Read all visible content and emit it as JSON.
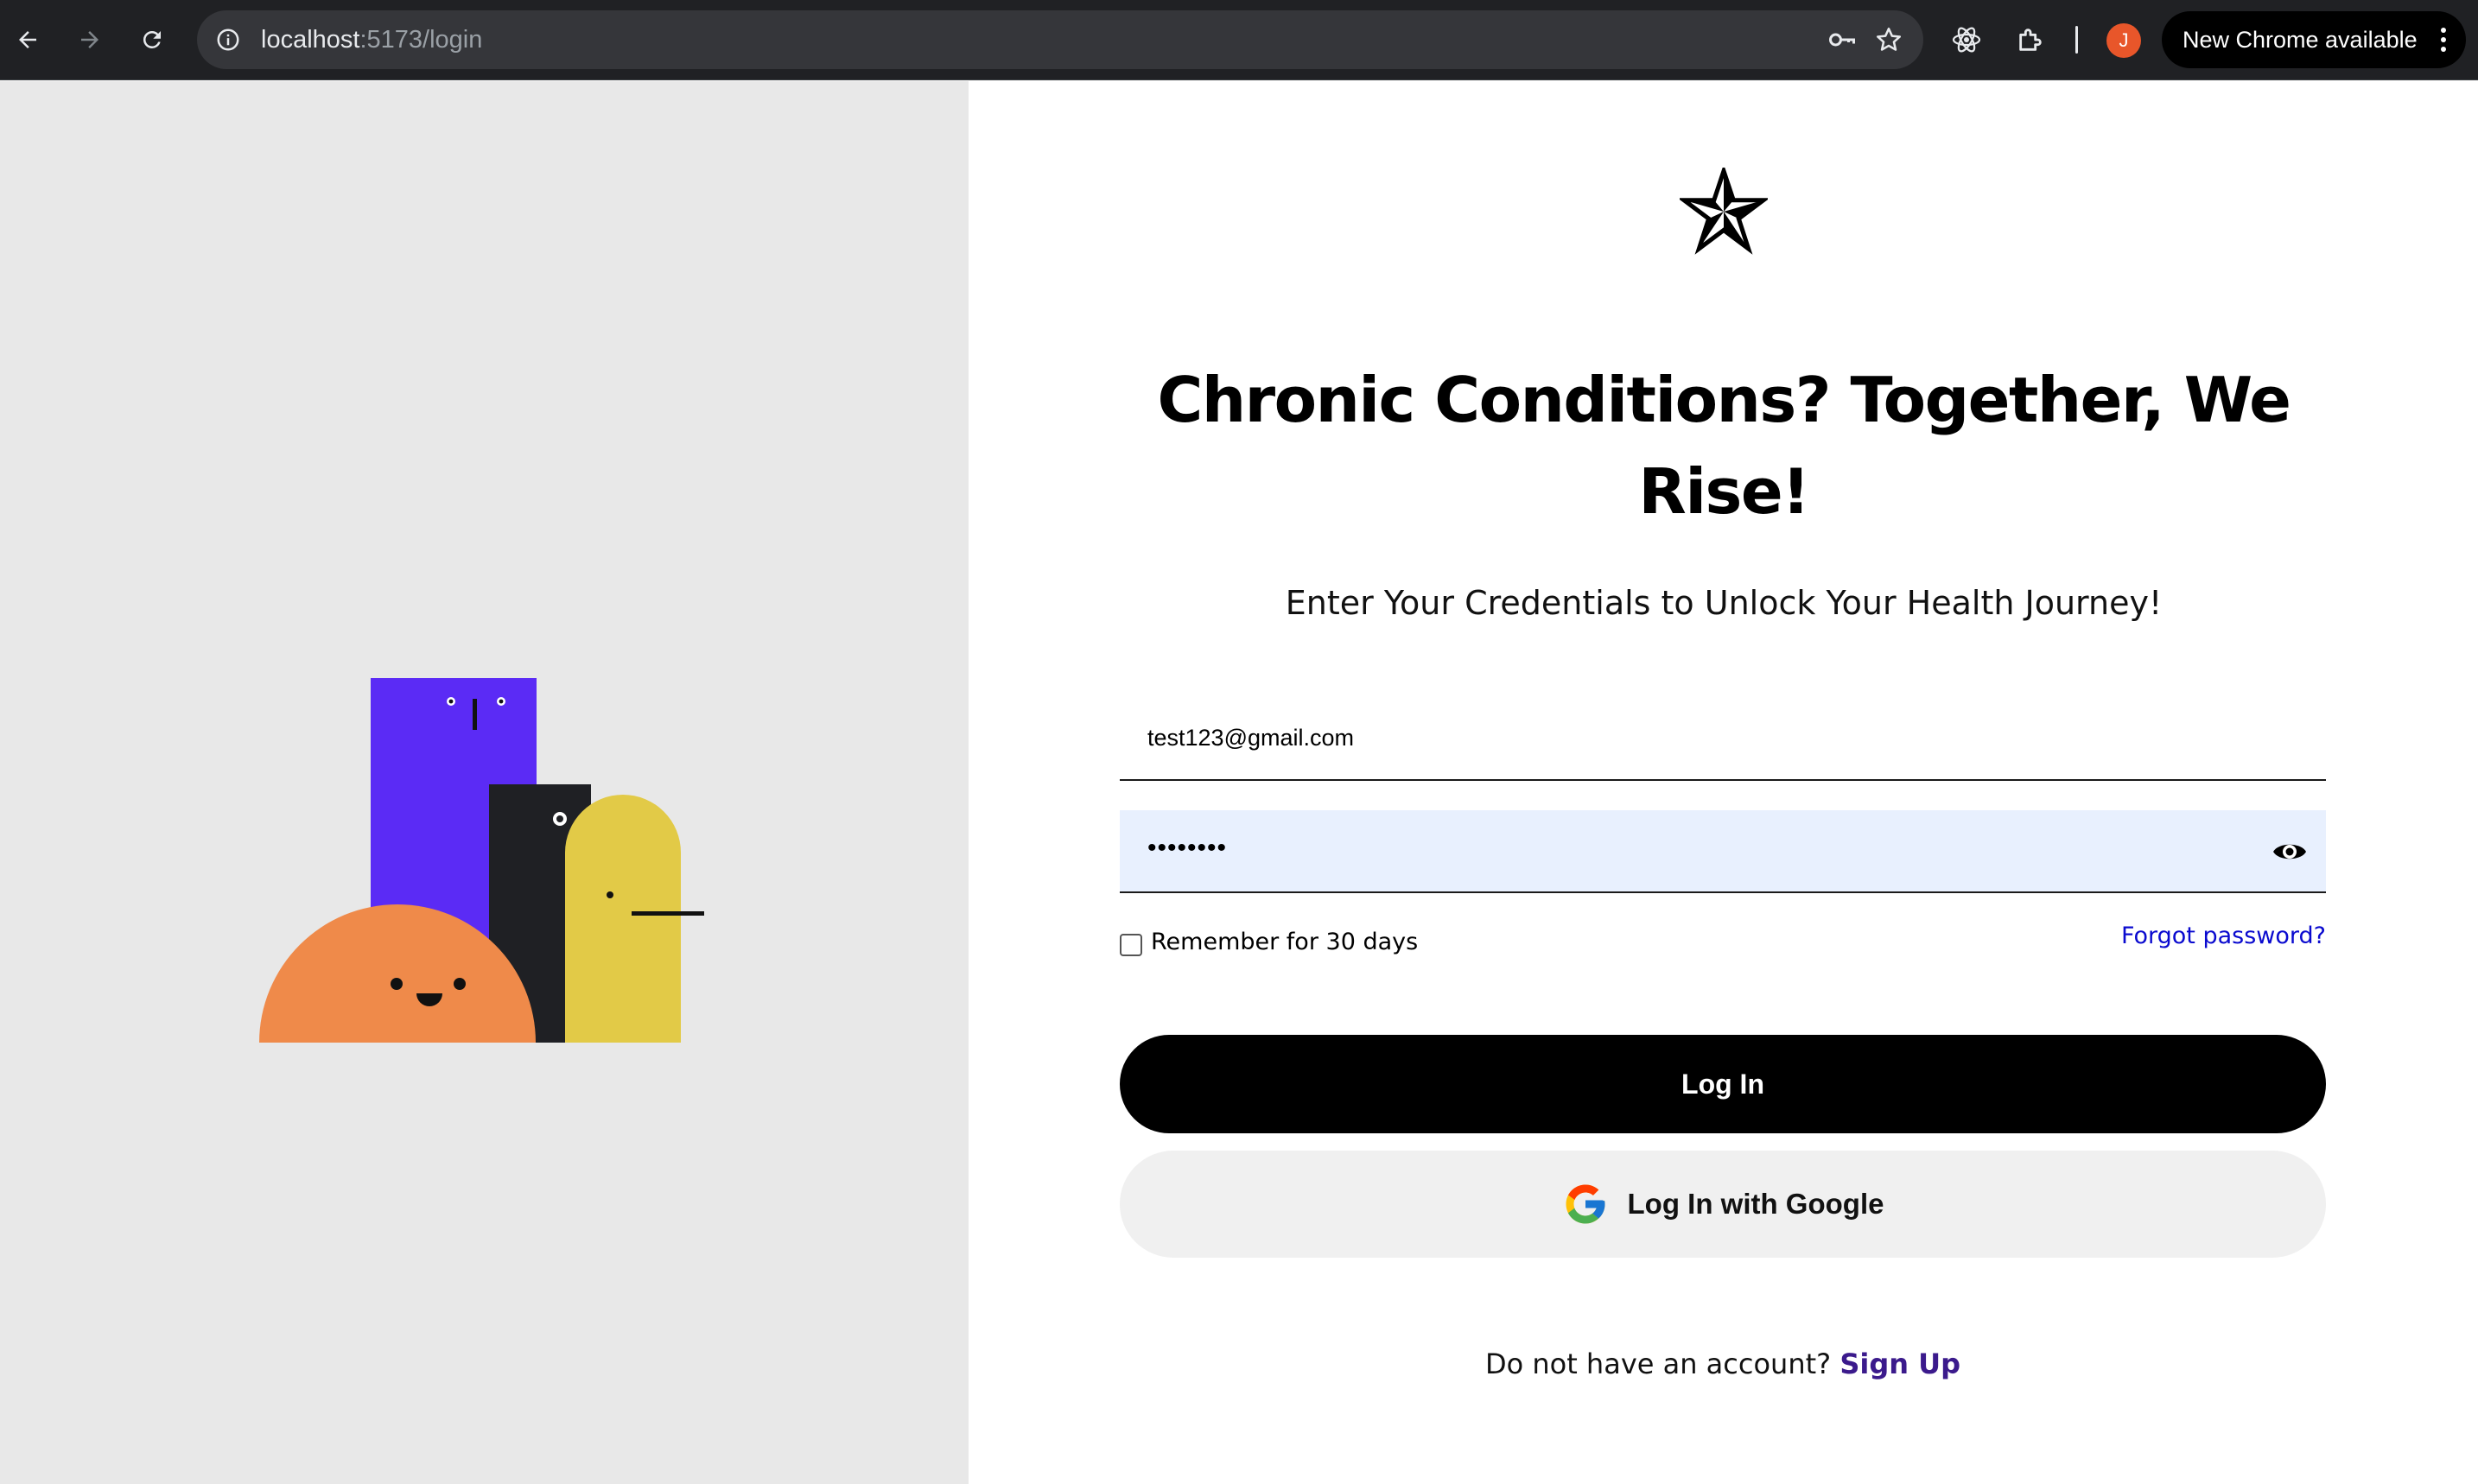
{
  "browser": {
    "url_host": "localhost",
    "url_path": ":5173/login",
    "update_label": "New Chrome available",
    "profile_initial": "J",
    "icons": [
      "back-arrow-icon",
      "forward-arrow-icon",
      "reload-icon",
      "site-info-icon",
      "password-key-icon",
      "bookmark-star-icon",
      "react-devtools-icon",
      "extensions-puzzle-icon",
      "more-vert-icon"
    ]
  },
  "colors": {
    "purple": "#5b2bf5",
    "dark": "#1f2024",
    "orange": "#ef8a4a",
    "yellow": "#e2ca47",
    "link_blue": "#0a0acf",
    "signup_purple": "#3b1a8c",
    "autofill_bg": "#e8f0fe"
  },
  "page": {
    "headline": "Chronic Conditions? Together, We Rise!",
    "subheadline": "Enter Your Credentials to Unlock Your Health Journey!",
    "email_value": "test123@gmail.com",
    "password_masked": "••••••••",
    "remember_label": "Remember for 30 days",
    "forgot_label": "Forgot password?",
    "login_label": "Log In",
    "google_label": "Log In with Google",
    "signup_prompt": "Do not have an account?",
    "signup_link": "Sign Up"
  }
}
